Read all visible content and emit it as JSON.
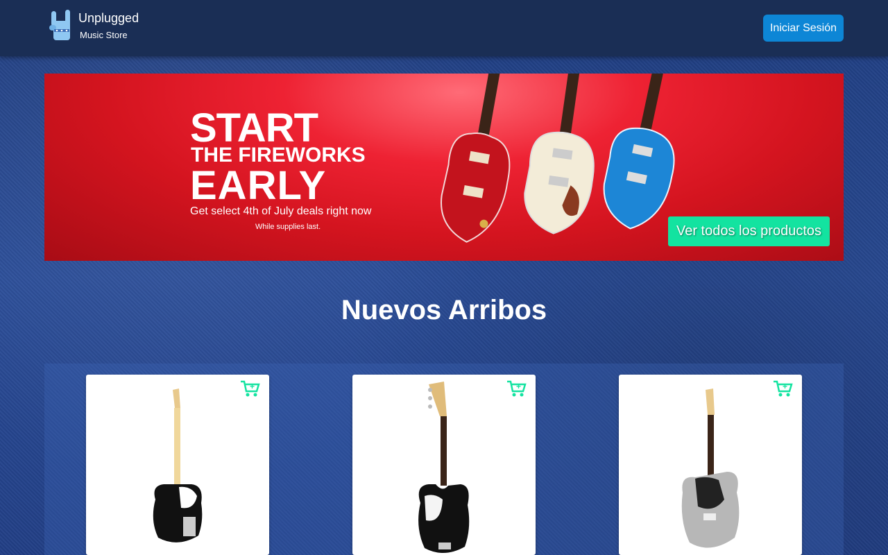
{
  "header": {
    "brand_name": "Unplugged",
    "brand_sub": "Music Store",
    "login_label": "Iniciar Sesión",
    "logo_icon": "rock-hand-icon"
  },
  "banner": {
    "line1": "START",
    "line2": "THE FIREWORKS",
    "line3": "EARLY",
    "deals": "Get select 4th of July deals right now",
    "supplies": "While supplies last.",
    "cta_label": "Ver todos los productos",
    "accent_color": "#ee2233"
  },
  "section": {
    "title": "Nuevos Arribos"
  },
  "products": [
    {
      "name": "telecaster-guitar",
      "cart_icon": "add-to-cart-icon"
    },
    {
      "name": "jazz-bass-guitar",
      "cart_icon": "add-to-cart-icon"
    },
    {
      "name": "jaguar-guitar",
      "cart_icon": "add-to-cart-icon"
    }
  ],
  "colors": {
    "header_bg": "#1a2e55",
    "login_btn": "#0d86d6",
    "cta_btn": "#13e3a0",
    "cart_icon": "#13e3a0"
  }
}
